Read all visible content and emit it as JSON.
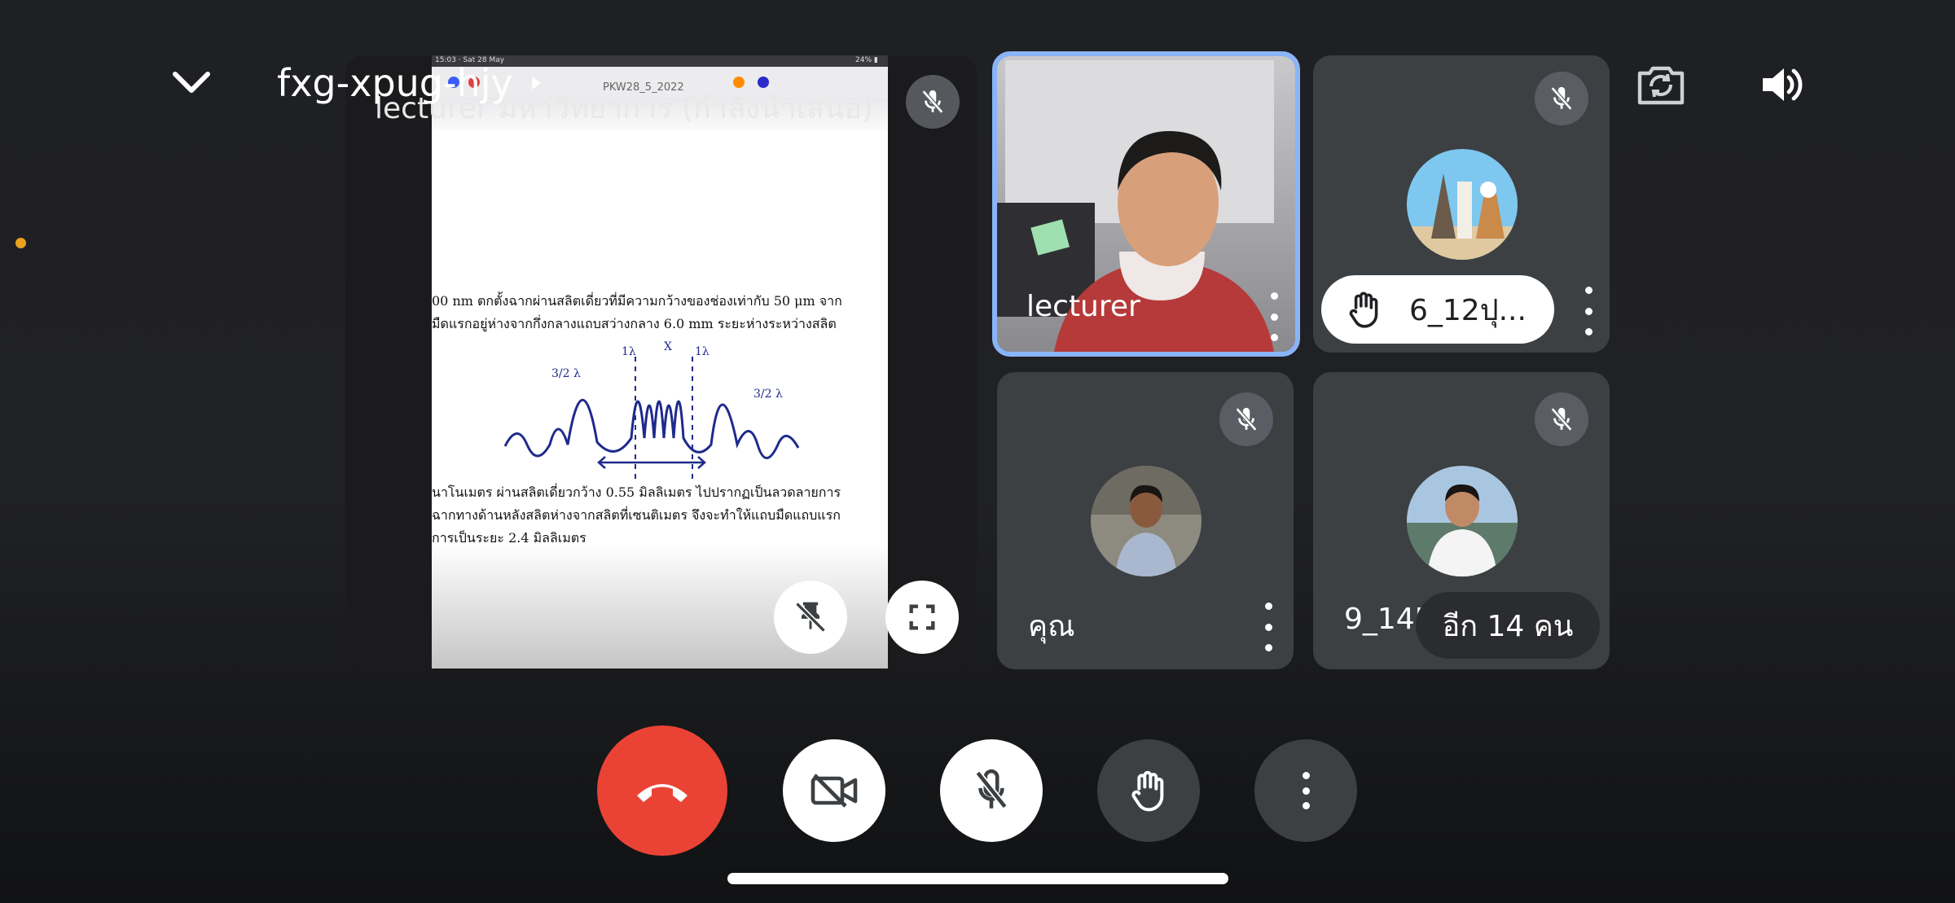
{
  "meeting": {
    "code": "fxg-xpug-hjy"
  },
  "presentation": {
    "title": "lecturer มหาวิทยาการ (กำลังนำเสนอ)",
    "status_bar_left": "15:03 · Sat 28 May",
    "doc_name": "PKW28_5_2022",
    "battery": "24% ▮",
    "line1": "00 nm ตกตั้งฉากผ่านสลิตเดี่ยวที่มีความกว้างของช่องเท่ากับ 50 μm จาก",
    "line2": "มืดแรกอยู่ห่างจากกึ่งกลางแถบสว่างกลาง 6.0 mm ระยะห่างระหว่างสลิต",
    "line3": "นาโนเมตร ผ่านสลิตเดี่ยวกว้าง 0.55 มิลลิเมตร ไปปรากฏเป็นลวดลายการ",
    "line4": "ฉากทางด้านหลังสลิตห่างจากสลิตที่เซนติเมตร จึงจะทำให้แถบมืดแถบแรก",
    "line5": "การเป็นระยะ 2.4 มิลลิเมตร",
    "sketch_labels": [
      "3/2 λ",
      "1λ",
      "1λ",
      "3/2 λ",
      "X"
    ]
  },
  "participants": {
    "lecturer": "lecturer",
    "hand_raised": "6_12ปุ...",
    "you": "คุณ",
    "other": "9_14P",
    "more": "อีก 14 คน"
  },
  "colors": {
    "accent": "#8ab4f8",
    "end_call": "#ea4335",
    "tile": "#3c4043"
  }
}
